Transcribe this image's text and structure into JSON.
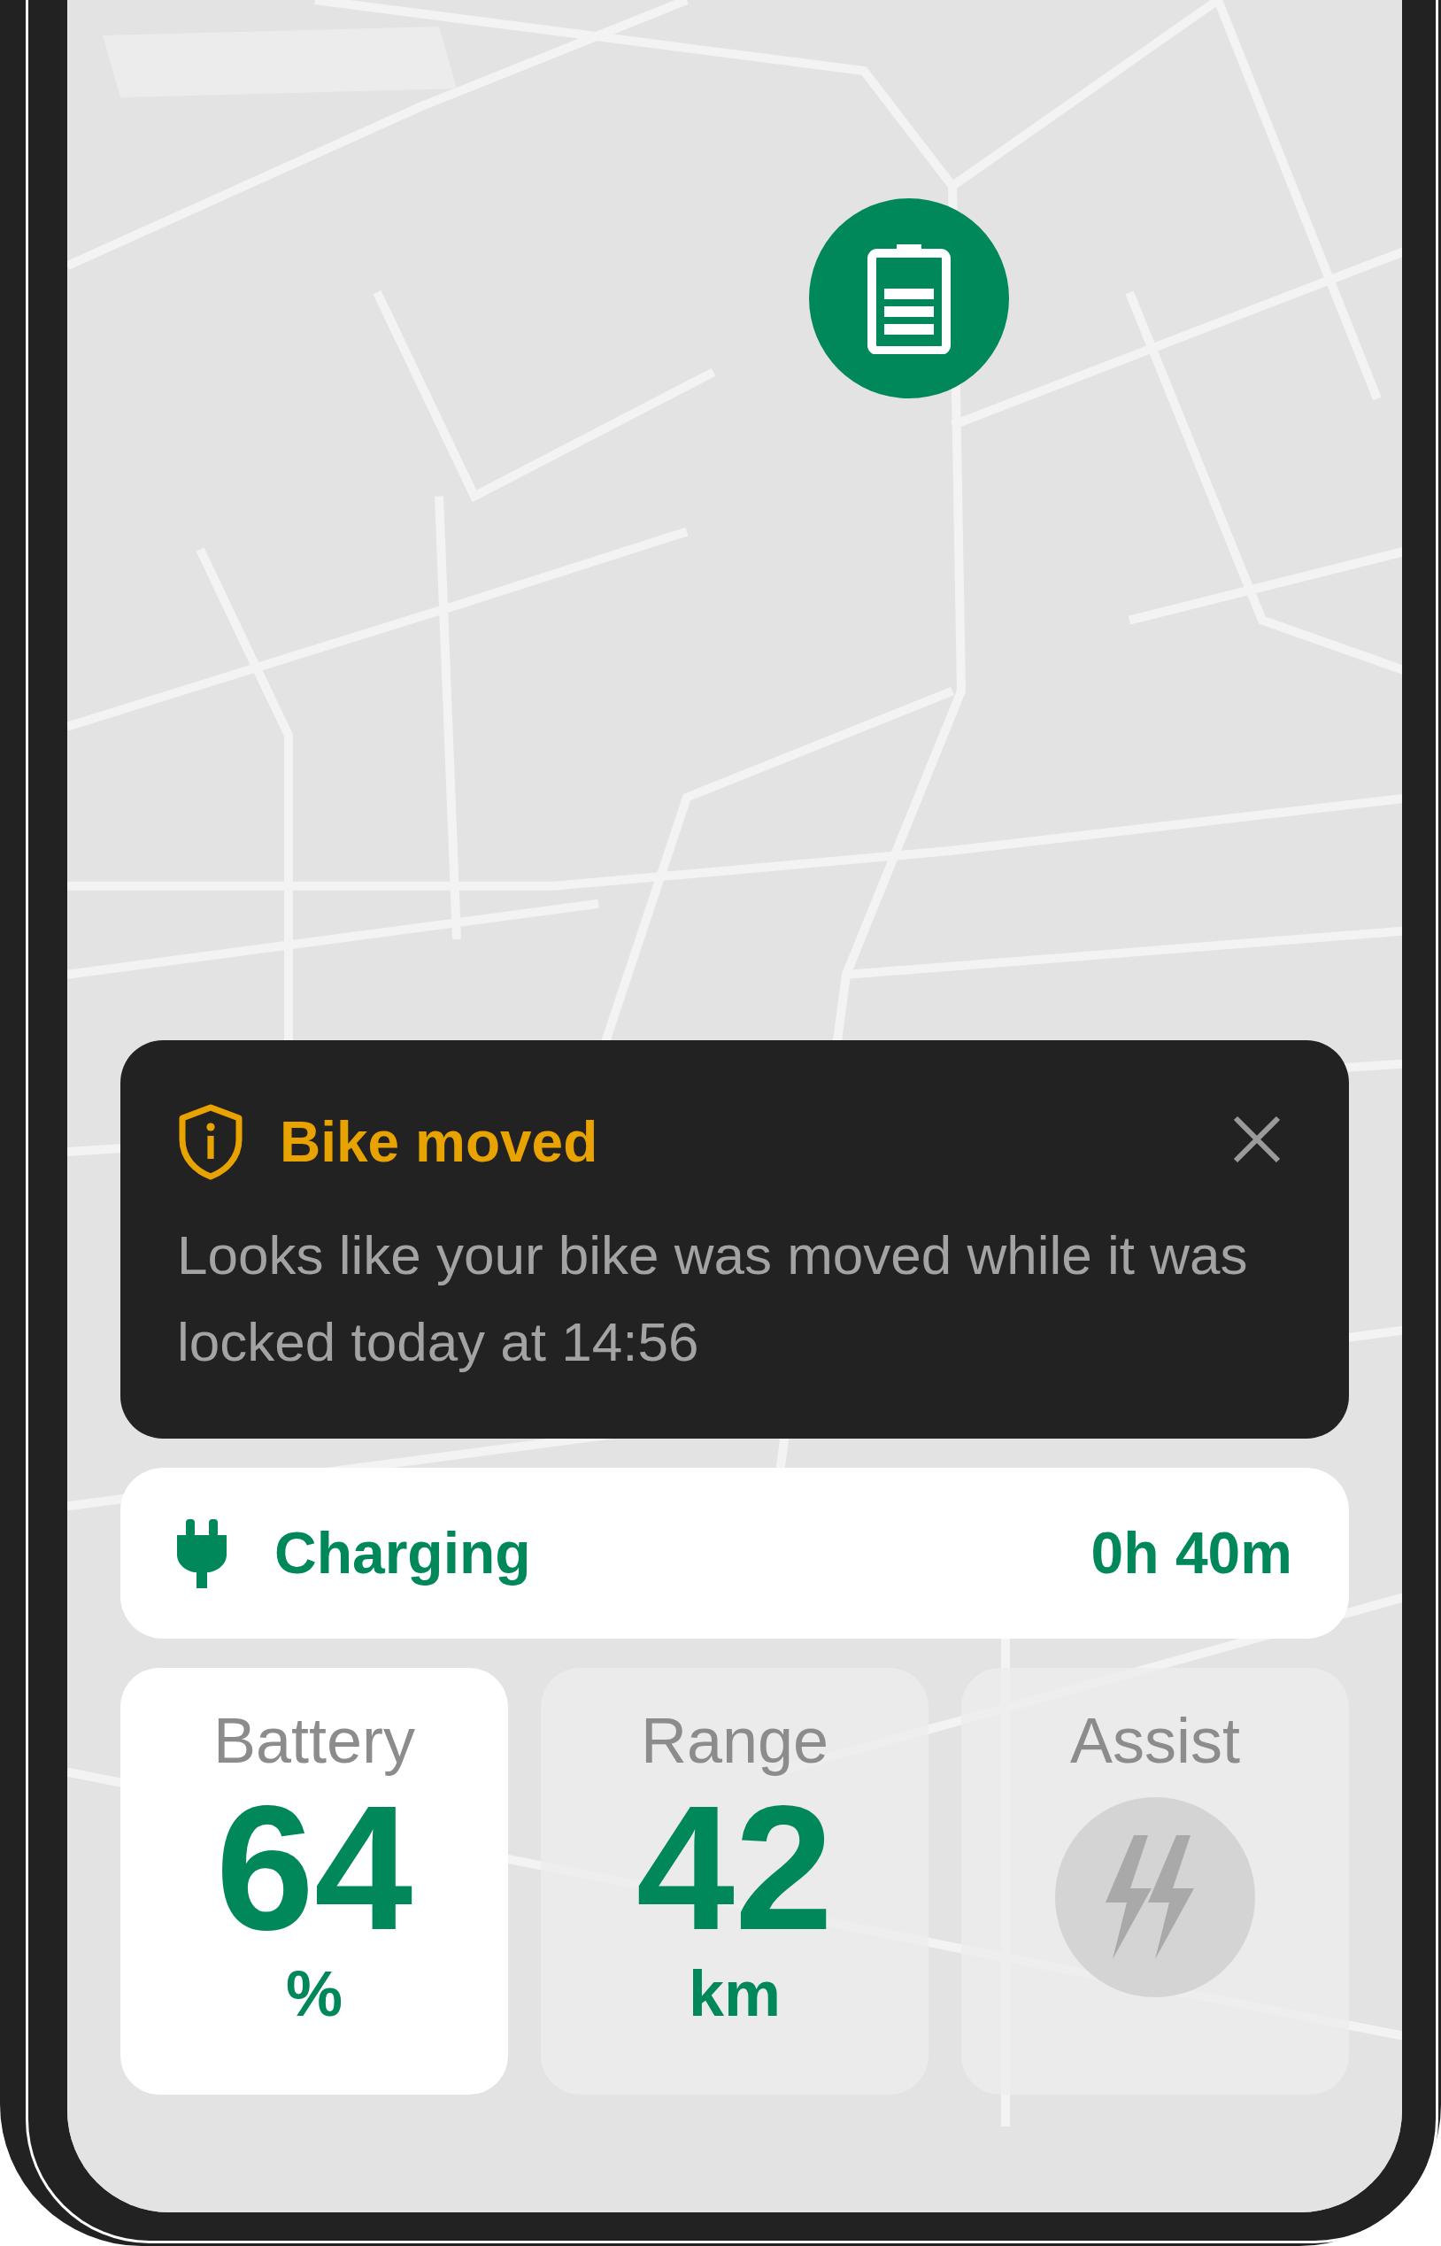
{
  "alert": {
    "title": "Bike moved",
    "message": "Looks like your bike was moved while it was locked today at 14:56"
  },
  "charging": {
    "label": "Charging",
    "time": "0h 40m"
  },
  "stats": [
    {
      "kind": "value",
      "label": "Battery",
      "value": "64",
      "unit": "%",
      "selected": true
    },
    {
      "kind": "value",
      "label": "Range",
      "value": "42",
      "unit": "km",
      "selected": false
    },
    {
      "kind": "icon",
      "label": "Assist",
      "selected": false
    }
  ]
}
